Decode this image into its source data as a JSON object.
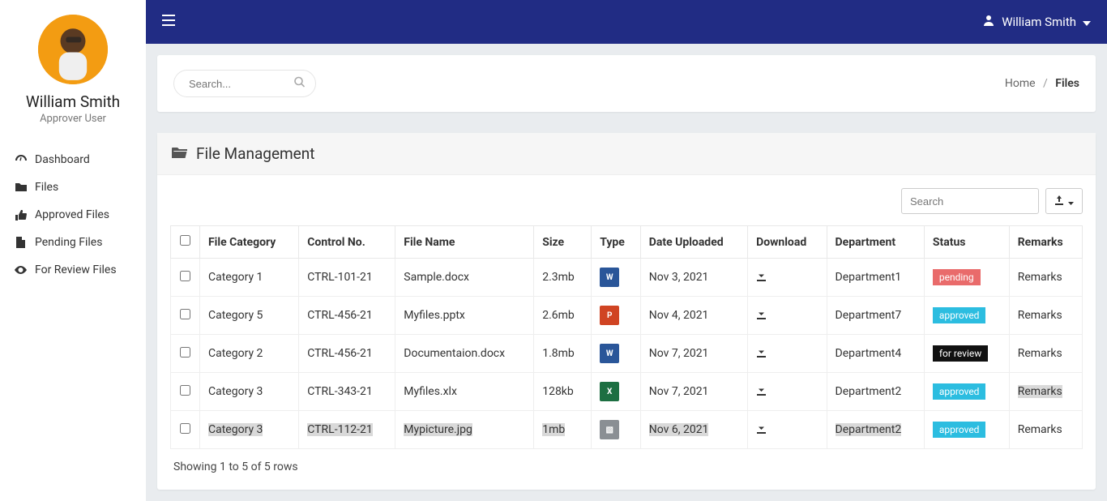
{
  "profile": {
    "name": "William Smith",
    "role": "Approver User"
  },
  "header": {
    "user_name": "William Smith"
  },
  "sidebar": {
    "items": [
      {
        "icon": "dashboard-icon",
        "label": "Dashboard"
      },
      {
        "icon": "folder-icon",
        "label": "Files"
      },
      {
        "icon": "thumbs-up-icon",
        "label": "Approved Files"
      },
      {
        "icon": "file-icon",
        "label": "Pending Files"
      },
      {
        "icon": "eye-icon",
        "label": "For Review Files"
      }
    ]
  },
  "search": {
    "placeholder": "Search..."
  },
  "breadcrumb": {
    "parent": "Home",
    "current": "Files"
  },
  "panel": {
    "title": "File Management"
  },
  "table": {
    "search_placeholder": "Search",
    "columns": [
      "",
      "File Category",
      "Control No.",
      "File Name",
      "Size",
      "Type",
      "Date Uploaded",
      "Download",
      "Department",
      "Status",
      "Remarks"
    ],
    "rows": [
      {
        "category": "Category 1",
        "control": "CTRL-101-21",
        "file": "Sample.docx",
        "size": "2.3mb",
        "type": "word",
        "date": "Nov 3, 2021",
        "dept": "Department1",
        "status": "pending",
        "remarks": "Remarks"
      },
      {
        "category": "Category 5",
        "control": "CTRL-456-21",
        "file": "Myfiles.pptx",
        "size": "2.6mb",
        "type": "ppt",
        "date": "Nov 4, 2021",
        "dept": "Department7",
        "status": "approved",
        "remarks": "Remarks"
      },
      {
        "category": "Category 2",
        "control": "CTRL-456-21",
        "file": "Documentaion.docx",
        "size": "1.8mb",
        "type": "word",
        "date": "Nov 7, 2021",
        "dept": "Department4",
        "status": "for review",
        "remarks": "Remarks"
      },
      {
        "category": "Category 3",
        "control": "CTRL-343-21",
        "file": "Myfiles.xlx",
        "size": "128kb",
        "type": "xls",
        "date": "Nov 7, 2021",
        "dept": "Department2",
        "status": "approved",
        "remarks": "Remarks",
        "remarks_hl": true
      },
      {
        "category": "Category 3",
        "control": "CTRL-112-21",
        "file": "Mypicture.jpg",
        "size": "1mb",
        "type": "img",
        "date": "Nov 6, 2021",
        "dept": "Department2",
        "status": "approved",
        "remarks": "Remarks",
        "hl": true
      }
    ],
    "pager": "Showing 1 to 5 of 5 rows"
  },
  "status_colors": {
    "pending": "b-pending",
    "approved": "b-approved",
    "for review": "b-review"
  },
  "type_icons": {
    "word": "ft-word",
    "ppt": "ft-ppt",
    "xls": "ft-xls",
    "img": "ft-img"
  },
  "type_labels": {
    "word": "W",
    "ppt": "P",
    "xls": "X",
    "img": "▧"
  }
}
